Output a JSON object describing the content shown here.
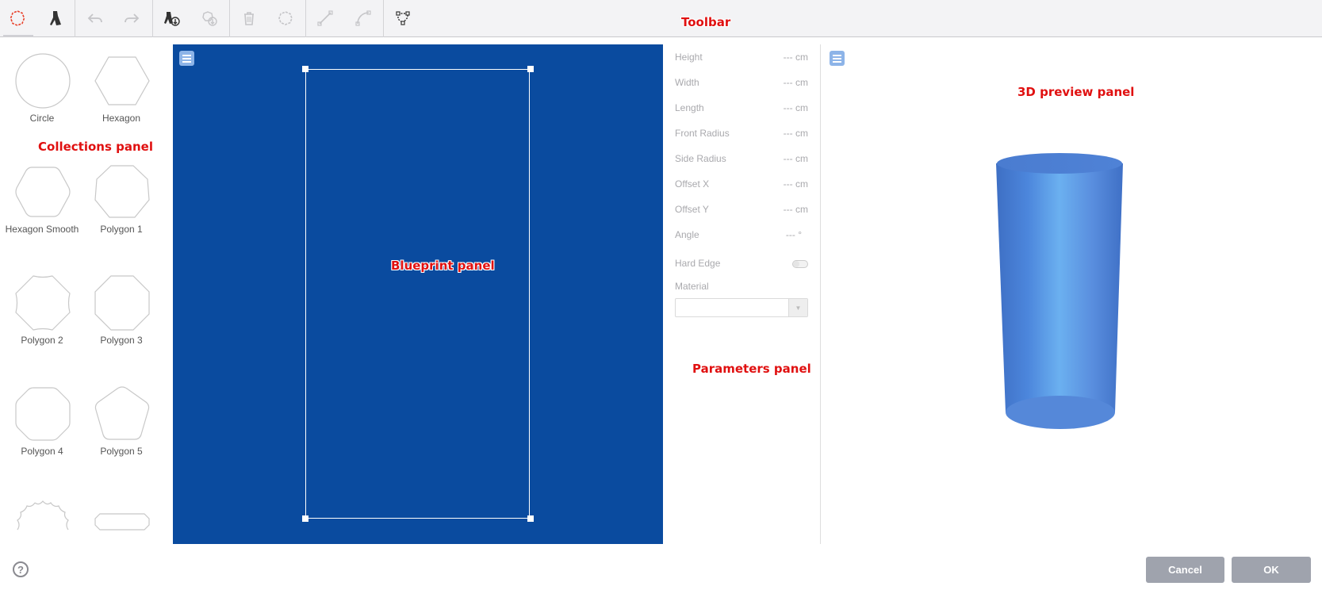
{
  "annotations": {
    "toolbar": "Toolbar",
    "collections": "Collections panel",
    "blueprint": "Blueprint panel",
    "parameters": "Parameters panel",
    "preview": "3D preview panel"
  },
  "toolbar": {
    "buttons": [
      "shape-profile",
      "silhouette",
      "undo",
      "redo",
      "import-profile",
      "save-to-collection",
      "delete",
      "reset-shape",
      "straight-segment",
      "curved-segment",
      "edit-points"
    ],
    "accent_color": "#e8402a"
  },
  "collections": {
    "items": [
      {
        "label": "Circle",
        "icon": "circle-shape-icon"
      },
      {
        "label": "Hexagon",
        "icon": "hexagon-shape-icon"
      },
      {
        "label": "Hexagon Smooth",
        "icon": "hexagon-smooth-shape-icon"
      },
      {
        "label": "Polygon 1",
        "icon": "polygon-1-shape-icon"
      },
      {
        "label": "Polygon 2",
        "icon": "polygon-2-shape-icon"
      },
      {
        "label": "Polygon 3",
        "icon": "polygon-3-shape-icon"
      },
      {
        "label": "Polygon 4",
        "icon": "polygon-4-shape-icon"
      },
      {
        "label": "Polygon 5",
        "icon": "polygon-5-shape-icon"
      }
    ]
  },
  "blueprint": {
    "background": "#0a4b9f"
  },
  "parameters": {
    "rows": [
      {
        "label": "Height",
        "value": "--- cm"
      },
      {
        "label": "Width",
        "value": "--- cm"
      },
      {
        "label": "Length",
        "value": "--- cm"
      },
      {
        "label": "Front Radius",
        "value": "--- cm"
      },
      {
        "label": "Side Radius",
        "value": "--- cm"
      },
      {
        "label": "Offset X",
        "value": "--- cm"
      },
      {
        "label": "Offset Y",
        "value": "--- cm"
      },
      {
        "label": "Angle",
        "value": "--- °"
      }
    ],
    "hard_edge_label": "Hard Edge",
    "hard_edge_on": false,
    "material_label": "Material",
    "material_value": ""
  },
  "preview": {
    "object_color": "#5b8fe0"
  },
  "footer": {
    "help": "?",
    "cancel": "Cancel",
    "ok": "OK"
  }
}
